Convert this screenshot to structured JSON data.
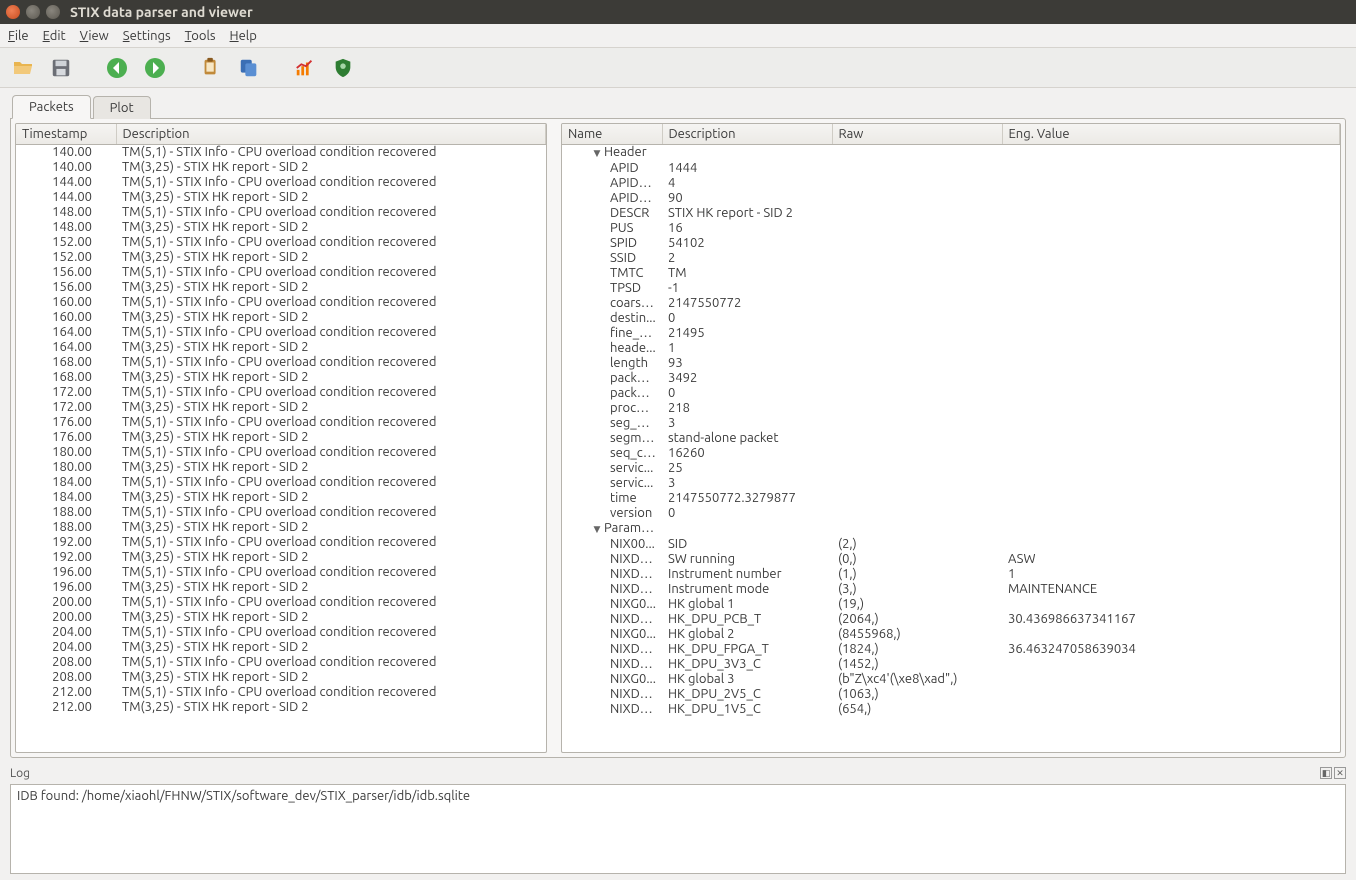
{
  "title": "STIX data parser and viewer",
  "menu": {
    "file": "File",
    "edit": "Edit",
    "view": "View",
    "settings": "Settings",
    "tools": "Tools",
    "help": "Help"
  },
  "tabs": {
    "packets": "Packets",
    "plot": "Plot"
  },
  "left_headers": {
    "timestamp": "Timestamp",
    "description": "Description"
  },
  "right_headers": {
    "name": "Name",
    "description": "Description",
    "raw": "Raw",
    "eng": "Eng. Value"
  },
  "packet_desc": {
    "a": "TM(5,1) - STIX Info - CPU overload condition recovered",
    "b": "TM(3,25) - STIX HK report - SID 2"
  },
  "packets": [
    [
      "140.00",
      "a"
    ],
    [
      "140.00",
      "b"
    ],
    [
      "144.00",
      "a"
    ],
    [
      "144.00",
      "b"
    ],
    [
      "148.00",
      "a"
    ],
    [
      "148.00",
      "b"
    ],
    [
      "152.00",
      "a"
    ],
    [
      "152.00",
      "b"
    ],
    [
      "156.00",
      "a"
    ],
    [
      "156.00",
      "b"
    ],
    [
      "160.00",
      "a"
    ],
    [
      "160.00",
      "b"
    ],
    [
      "164.00",
      "a"
    ],
    [
      "164.00",
      "b"
    ],
    [
      "168.00",
      "a"
    ],
    [
      "168.00",
      "b"
    ],
    [
      "172.00",
      "a"
    ],
    [
      "172.00",
      "b"
    ],
    [
      "176.00",
      "a"
    ],
    [
      "176.00",
      "b"
    ],
    [
      "180.00",
      "a"
    ],
    [
      "180.00",
      "b"
    ],
    [
      "184.00",
      "a"
    ],
    [
      "184.00",
      "b"
    ],
    [
      "188.00",
      "a"
    ],
    [
      "188.00",
      "b"
    ],
    [
      "192.00",
      "a"
    ],
    [
      "192.00",
      "b"
    ],
    [
      "196.00",
      "a"
    ],
    [
      "196.00",
      "b"
    ],
    [
      "200.00",
      "a"
    ],
    [
      "200.00",
      "b"
    ],
    [
      "204.00",
      "a"
    ],
    [
      "204.00",
      "b"
    ],
    [
      "208.00",
      "a"
    ],
    [
      "208.00",
      "b"
    ],
    [
      "212.00",
      "a"
    ],
    [
      "212.00",
      "b"
    ]
  ],
  "tree": [
    {
      "type": "group",
      "name": "Header"
    },
    {
      "type": "kv",
      "name": "APID",
      "desc": "1444"
    },
    {
      "type": "kv",
      "name": "APID_p...",
      "desc": "4"
    },
    {
      "type": "kv",
      "name": "APID_p...",
      "desc": "90"
    },
    {
      "type": "kv",
      "name": "DESCR",
      "desc": "STIX HK report - SID 2"
    },
    {
      "type": "kv",
      "name": "PUS",
      "desc": "16"
    },
    {
      "type": "kv",
      "name": "SPID",
      "desc": "54102"
    },
    {
      "type": "kv",
      "name": "SSID",
      "desc": "2"
    },
    {
      "type": "kv",
      "name": "TMTC",
      "desc": "TM"
    },
    {
      "type": "kv",
      "name": "TPSD",
      "desc": "-1"
    },
    {
      "type": "kv",
      "name": "coarse...",
      "desc": "2147550772"
    },
    {
      "type": "kv",
      "name": "destin...",
      "desc": "0"
    },
    {
      "type": "kv",
      "name": "fine_ti...",
      "desc": "21495"
    },
    {
      "type": "kv",
      "name": "heade...",
      "desc": "1"
    },
    {
      "type": "kv",
      "name": "length",
      "desc": "93"
    },
    {
      "type": "kv",
      "name": "packet...",
      "desc": "3492"
    },
    {
      "type": "kv",
      "name": "packet...",
      "desc": "0"
    },
    {
      "type": "kv",
      "name": "proces...",
      "desc": "218"
    },
    {
      "type": "kv",
      "name": "seg_flag",
      "desc": "3"
    },
    {
      "type": "kv",
      "name": "segme...",
      "desc": "stand-alone packet"
    },
    {
      "type": "kv",
      "name": "seq_co...",
      "desc": "16260"
    },
    {
      "type": "kv",
      "name": "servic...",
      "desc": "25"
    },
    {
      "type": "kv",
      "name": "servic...",
      "desc": "3"
    },
    {
      "type": "kv",
      "name": "time",
      "desc": "2147550772.3279877"
    },
    {
      "type": "kv",
      "name": "version",
      "desc": "0"
    },
    {
      "type": "group",
      "name": "Parameters"
    },
    {
      "type": "param",
      "name": "NIX00...",
      "desc": "SID",
      "raw": "(2,)",
      "eng": ""
    },
    {
      "type": "param",
      "name": "NIXD0...",
      "desc": "SW running",
      "raw": "(0,)",
      "eng": "ASW"
    },
    {
      "type": "param",
      "name": "NIXD0...",
      "desc": "Instrument number",
      "raw": "(1,)",
      "eng": "1"
    },
    {
      "type": "param",
      "name": "NIXD0...",
      "desc": "Instrument mode",
      "raw": "(3,)",
      "eng": "MAINTENANCE"
    },
    {
      "type": "param",
      "name": "NIXG0...",
      "desc": "HK global 1",
      "raw": "(19,)",
      "eng": ""
    },
    {
      "type": "param",
      "name": "NIXD0...",
      "desc": "HK_DPU_PCB_T",
      "raw": "(2064,)",
      "eng": "30.436986637341167"
    },
    {
      "type": "param",
      "name": "NIXG0...",
      "desc": "HK global 2",
      "raw": "(8455968,)",
      "eng": ""
    },
    {
      "type": "param",
      "name": "NIXD0...",
      "desc": "HK_DPU_FPGA_T",
      "raw": "(1824,)",
      "eng": "36.463247058639034"
    },
    {
      "type": "param",
      "name": "NIXD0...",
      "desc": "HK_DPU_3V3_C",
      "raw": "(1452,)",
      "eng": ""
    },
    {
      "type": "param",
      "name": "NIXG0...",
      "desc": "HK global 3",
      "raw": "(b\"Z\\xc4'(\\xe8\\xad\",)",
      "eng": ""
    },
    {
      "type": "param",
      "name": "NIXD0...",
      "desc": "HK_DPU_2V5_C",
      "raw": "(1063,)",
      "eng": ""
    },
    {
      "type": "param",
      "name": "NIXD0...",
      "desc": "HK_DPU_1V5_C",
      "raw": "(654,)",
      "eng": ""
    }
  ],
  "log": {
    "label": "Log",
    "line": "IDB found: /home/xiaohl/FHNW/STIX/software_dev/STIX_parser/idb/idb.sqlite"
  }
}
